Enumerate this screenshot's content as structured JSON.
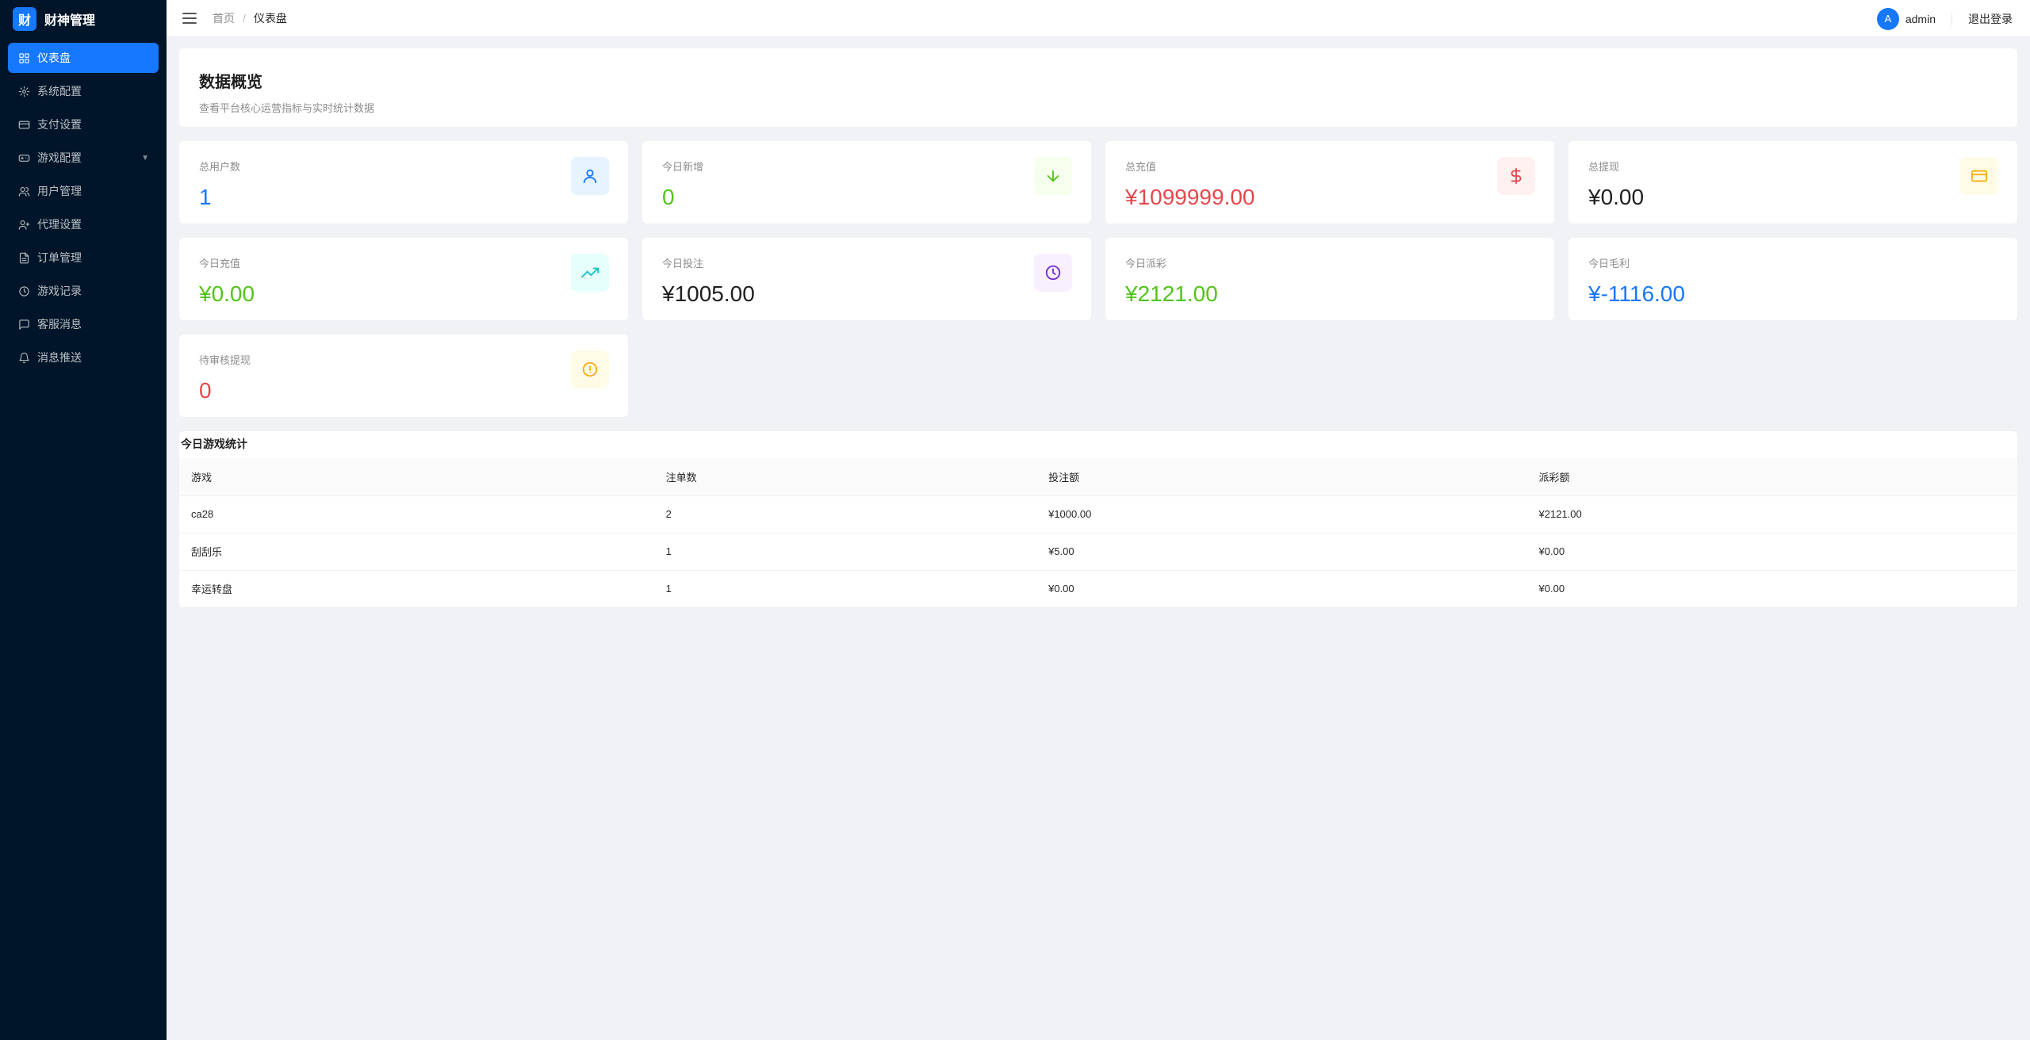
{
  "app": {
    "logo_char": "财",
    "name": "财神管理"
  },
  "sidebar": {
    "items": [
      {
        "label": "仪表盘",
        "icon": "dashboard-icon",
        "active": true
      },
      {
        "label": "系统配置",
        "icon": "gear-icon"
      },
      {
        "label": "支付设置",
        "icon": "card-icon"
      },
      {
        "label": "游戏配置",
        "icon": "gamepad-icon",
        "has_arrow": true
      },
      {
        "label": "用户管理",
        "icon": "users-icon"
      },
      {
        "label": "代理设置",
        "icon": "user-plus-icon"
      },
      {
        "label": "订单管理",
        "icon": "document-icon"
      },
      {
        "label": "游戏记录",
        "icon": "clock-icon"
      },
      {
        "label": "客服消息",
        "icon": "message-icon"
      },
      {
        "label": "消息推送",
        "icon": "bell-icon"
      }
    ],
    "arrow": "▼"
  },
  "header": {
    "breadcrumb": {
      "home": "首页",
      "separator": "/",
      "current": "仪表盘"
    },
    "user": {
      "avatar_letter": "A",
      "name": "admin"
    },
    "logout": "退出登录"
  },
  "overview": {
    "title": "数据概览",
    "subtitle": "查看平台核心运营指标与实时统计数据"
  },
  "stats": [
    {
      "label": "总用户数",
      "value": "1",
      "color": "#1677ff",
      "icon": "user-icon",
      "icon_color": "#1677ff",
      "icon_bg": "#e6f4ff"
    },
    {
      "label": "今日新增",
      "value": "0",
      "color": "#52c41a",
      "icon": "arrow-down-icon",
      "icon_color": "#52c41a",
      "icon_bg": "#f6ffed"
    },
    {
      "label": "总充值",
      "value": "¥1099999.00",
      "color": "#e5484d",
      "icon": "dollar-icon",
      "icon_color": "#e5484d",
      "icon_bg": "#fff1f0"
    },
    {
      "label": "总提现",
      "value": "¥0.00",
      "color": "#1f1f1f",
      "icon": "card-icon",
      "icon_color": "#faad14",
      "icon_bg": "#fffbe6"
    },
    {
      "label": "今日充值",
      "value": "¥0.00",
      "color": "#52c41a",
      "icon": "trending-up-icon",
      "icon_color": "#13c2c2",
      "icon_bg": "#e6fffb"
    },
    {
      "label": "今日投注",
      "value": "¥1005.00",
      "color": "#1f1f1f",
      "icon": "clock-icon",
      "icon_color": "#722ed1",
      "icon_bg": "#f9f0ff"
    },
    {
      "label": "今日派彩",
      "value": "¥2121.00",
      "color": "#52c41a"
    },
    {
      "label": "今日毛利",
      "value": "¥-1116.00",
      "color": "#1677ff"
    },
    {
      "label": "待审核提现",
      "value": "0",
      "color": "#e5484d",
      "icon": "alert-icon",
      "icon_color": "#faad14",
      "icon_bg": "#fffbe6"
    }
  ],
  "game_table": {
    "title": "今日游戏统计",
    "columns": [
      "游戏",
      "注单数",
      "投注额",
      "派彩额"
    ],
    "rows": [
      [
        "ca28",
        "2",
        "¥1000.00",
        "¥2121.00"
      ],
      [
        "刮刮乐",
        "1",
        "¥5.00",
        "¥0.00"
      ],
      [
        "幸运转盘",
        "1",
        "¥0.00",
        "¥0.00"
      ]
    ]
  }
}
